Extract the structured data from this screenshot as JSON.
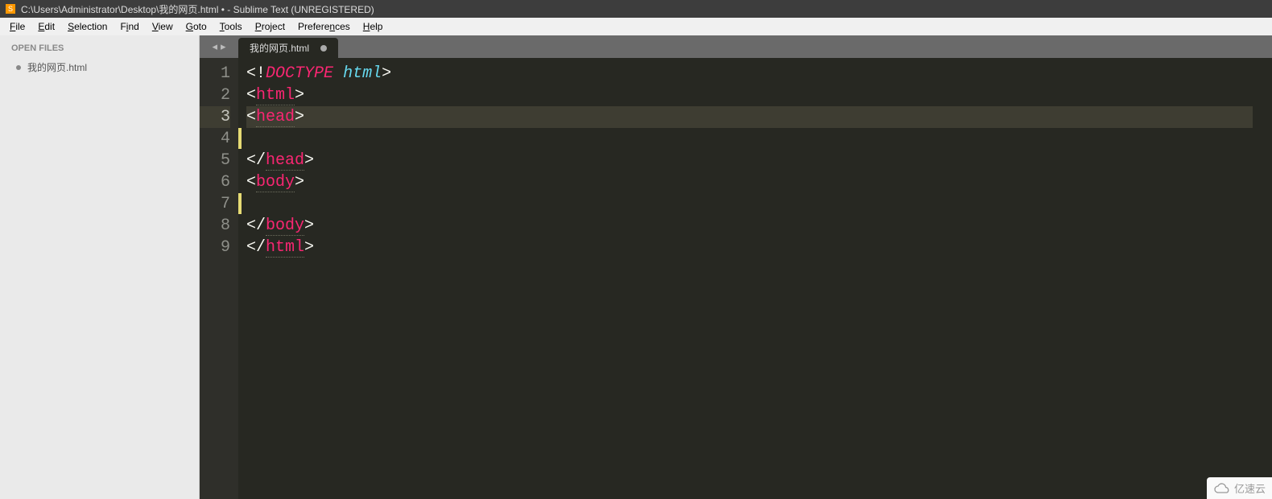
{
  "titlebar": {
    "path": "C:\\Users\\Administrator\\Desktop\\我的网页.html • - Sublime Text (UNREGISTERED)"
  },
  "menubar": {
    "items": [
      {
        "label": "File",
        "u": "F"
      },
      {
        "label": "Edit",
        "u": "E"
      },
      {
        "label": "Selection",
        "u": "S"
      },
      {
        "label": "Find",
        "u": "i"
      },
      {
        "label": "View",
        "u": "V"
      },
      {
        "label": "Goto",
        "u": "G"
      },
      {
        "label": "Tools",
        "u": "T"
      },
      {
        "label": "Project",
        "u": "P"
      },
      {
        "label": "Preferences",
        "u": "n"
      },
      {
        "label": "Help",
        "u": "H"
      }
    ]
  },
  "sidebar": {
    "open_files_header": "OPEN FILES",
    "items": [
      {
        "label": "我的网页.html"
      }
    ]
  },
  "tabs": {
    "active": {
      "label": "我的网页.html",
      "dirty": true
    }
  },
  "editor": {
    "current_line": 3,
    "lines": [
      {
        "n": 1,
        "tokens": [
          {
            "t": "<",
            "c": "punct"
          },
          {
            "t": "!",
            "c": "punct"
          },
          {
            "t": "DOCTYPE",
            "c": "doctype"
          },
          {
            "t": " ",
            "c": "punct"
          },
          {
            "t": "html",
            "c": "doctype-name"
          },
          {
            "t": ">",
            "c": "punct"
          }
        ]
      },
      {
        "n": 2,
        "tokens": [
          {
            "t": "<",
            "c": "punct"
          },
          {
            "t": "html",
            "c": "tag"
          },
          {
            "t": ">",
            "c": "punct"
          }
        ]
      },
      {
        "n": 3,
        "tokens": [
          {
            "t": "<",
            "c": "punct"
          },
          {
            "t": "head",
            "c": "tag"
          },
          {
            "t": ">",
            "c": "punct"
          }
        ]
      },
      {
        "n": 4,
        "tokens": []
      },
      {
        "n": 5,
        "tokens": [
          {
            "t": "</",
            "c": "punct"
          },
          {
            "t": "head",
            "c": "tag"
          },
          {
            "t": ">",
            "c": "punct"
          }
        ]
      },
      {
        "n": 6,
        "tokens": [
          {
            "t": "<",
            "c": "punct"
          },
          {
            "t": "body",
            "c": "tag"
          },
          {
            "t": ">",
            "c": "punct"
          }
        ]
      },
      {
        "n": 7,
        "tokens": []
      },
      {
        "n": 8,
        "tokens": [
          {
            "t": "</",
            "c": "punct"
          },
          {
            "t": "body",
            "c": "tag"
          },
          {
            "t": ">",
            "c": "punct"
          }
        ]
      },
      {
        "n": 9,
        "tokens": [
          {
            "t": "</",
            "c": "punct"
          },
          {
            "t": "html",
            "c": "tag"
          },
          {
            "t": ">",
            "c": "punct"
          }
        ]
      }
    ],
    "fold_marks_at": [
      4,
      7
    ]
  },
  "watermark": {
    "label": "亿速云"
  }
}
